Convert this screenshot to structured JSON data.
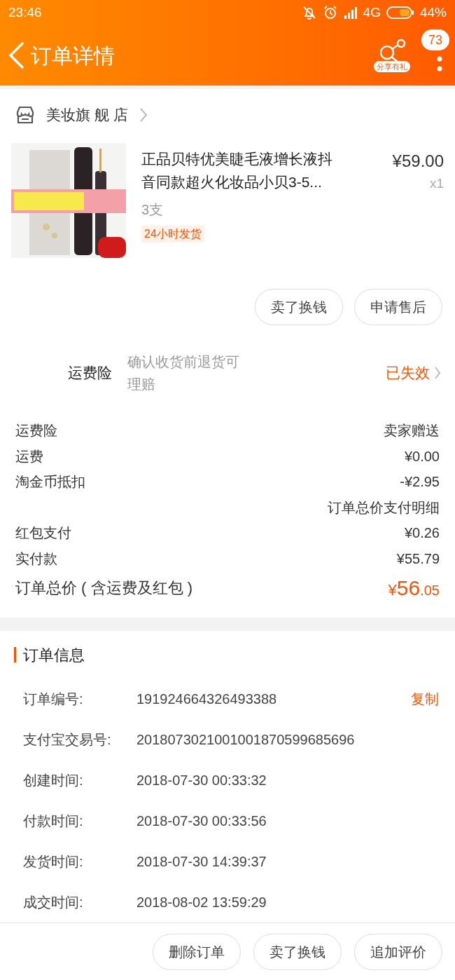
{
  "status_bar": {
    "time": "23:46",
    "network": "4G",
    "battery": "44%"
  },
  "header": {
    "title": "订单详情",
    "share_label": "分享有礼",
    "badge": "73"
  },
  "store": {
    "name": "美妆旗 舰 店"
  },
  "product": {
    "kind": "picture",
    "title": "正品贝特优美睫毛液增长液抖音同款超火化妆品小贝3-5...",
    "variant": "3支",
    "tag": "24小时发货",
    "price": "¥59.00",
    "quantity": "x1"
  },
  "product_actions": [
    "卖了换钱",
    "申请售后"
  ],
  "insurance": {
    "label": "运费险",
    "description": "确认收货前退货可理赔",
    "status": "已失效"
  },
  "price_rows": [
    {
      "kind": "row",
      "label": "运费险",
      "value": "卖家赠送"
    },
    {
      "kind": "row",
      "label": "运费",
      "value": "¥0.00"
    },
    {
      "kind": "row",
      "label": "淘金币抵扣",
      "value": "-¥2.95"
    },
    {
      "kind": "note",
      "value": "订单总价支付明细"
    },
    {
      "kind": "row",
      "label": "红包支付",
      "value": "¥0.26"
    },
    {
      "kind": "row",
      "label": "实付款",
      "value": "¥55.79"
    },
    {
      "kind": "total",
      "label": "订单总价 ( 含运费及红包 )",
      "currency": "¥",
      "integer": "56",
      "decimal": ".05"
    }
  ],
  "order_info": {
    "title": "订单信息",
    "rows": [
      {
        "label": "订单编号:",
        "value": "191924664326493388",
        "action": "复制"
      },
      {
        "label": "支付宝交易号:",
        "value": "2018073021001001870599685696"
      },
      {
        "label": "创建时间:",
        "value": "2018-07-30 00:33:32"
      },
      {
        "label": "付款时间:",
        "value": "2018-07-30 00:33:56"
      },
      {
        "label": "发货时间:",
        "value": "2018-07-30 14:39:37"
      },
      {
        "label": "成交时间:",
        "value": "2018-08-02 13:59:29"
      }
    ]
  },
  "bottom_actions": [
    "删除订单",
    "卖了换钱",
    "追加评价"
  ]
}
